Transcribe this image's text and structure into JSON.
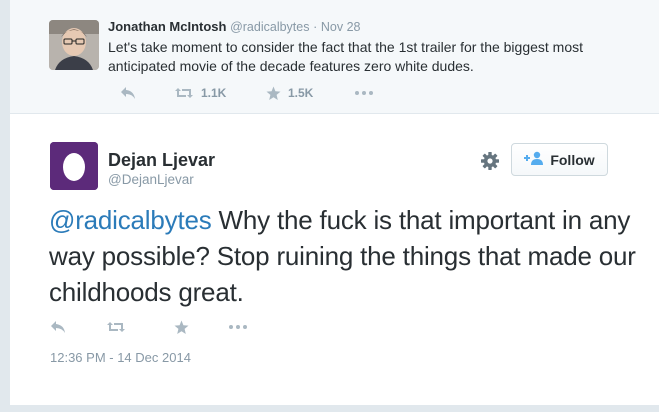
{
  "parent_tweet": {
    "author_name": "Jonathan McIntosh",
    "author_handle": "@radicalbytes",
    "separator": "·",
    "date": "Nov 28",
    "text": "Let's take moment to consider the fact that the 1st trailer for the biggest most anticipated movie of the decade features zero white dudes.",
    "retweet_count": "1.1K",
    "favorite_count": "1.5K"
  },
  "main_tweet": {
    "author_name": "Dejan Ljevar",
    "author_handle": "@DejanLjevar",
    "mention": "@radicalbytes",
    "text": " Why the fuck is that important in any way possible? Stop ruining the things that made our childhoods great.",
    "timestamp": "12:36 PM - 14 Dec 2014",
    "follow_label": "Follow"
  },
  "colors": {
    "accent_link": "#2b7bb9",
    "egg_avatar_bg": "#5c2a7a",
    "muted_text": "#8899a6",
    "icon": "#aab8c2"
  },
  "icons": [
    "reply-icon",
    "retweet-icon",
    "favorite-icon",
    "more-icon",
    "gear-icon",
    "follow-person-icon"
  ]
}
